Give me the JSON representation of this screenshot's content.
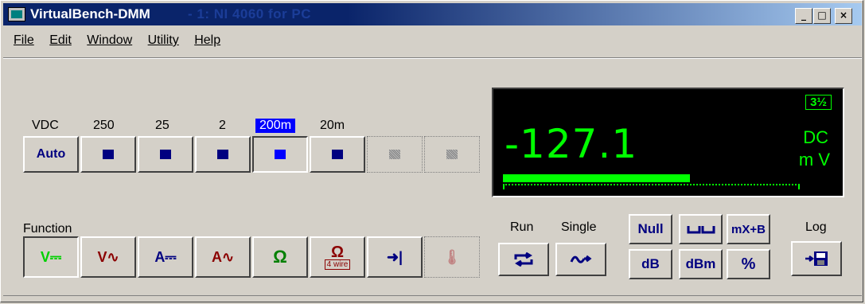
{
  "window": {
    "title": "VirtualBench-DMM",
    "title_ghost": "- 1: NI 4060 for PC",
    "controls": [
      "_",
      "□",
      "×"
    ]
  },
  "menu": [
    {
      "label": "File"
    },
    {
      "label": "Edit"
    },
    {
      "label": "Window"
    },
    {
      "label": "Utility"
    },
    {
      "label": "Help"
    }
  ],
  "range": {
    "mode_label": "VDC",
    "ranges": [
      "250",
      "25",
      "2",
      "200m",
      "20m"
    ],
    "selected": "200m",
    "auto_label": "Auto"
  },
  "display": {
    "reading": "-127.1",
    "resolution": "3½",
    "mode": "DC",
    "unit": "m V",
    "bar_fraction": 0.63
  },
  "function": {
    "label": "Function",
    "buttons": [
      {
        "label": "V⎓",
        "name": "dc-volts-button",
        "color": "#00d000"
      },
      {
        "label": "V∿",
        "name": "ac-volts-button",
        "color": "#8b0000"
      },
      {
        "label": "A⎓",
        "name": "dc-amps-button",
        "color": "#000080"
      },
      {
        "label": "A∿",
        "name": "ac-amps-button",
        "color": "#8b0000"
      },
      {
        "label": "Ω",
        "name": "ohms-button",
        "color": "#008000"
      },
      {
        "label": "Ω",
        "sub": "4 wire",
        "name": "ohms-4wire-button",
        "color": "#8b0000"
      },
      {
        "label": "➜|",
        "name": "diode-button",
        "color": "#000080"
      },
      {
        "label": "🌡",
        "name": "temperature-button",
        "color": "#c08080"
      }
    ]
  },
  "acquire": {
    "run_label": "Run",
    "single_label": "Single"
  },
  "math": {
    "null_label": "Null",
    "dB_label": "dB",
    "dBm_label": "dBm",
    "mxb_label": "mX+B",
    "percent_label": "%"
  },
  "log": {
    "label": "Log"
  }
}
